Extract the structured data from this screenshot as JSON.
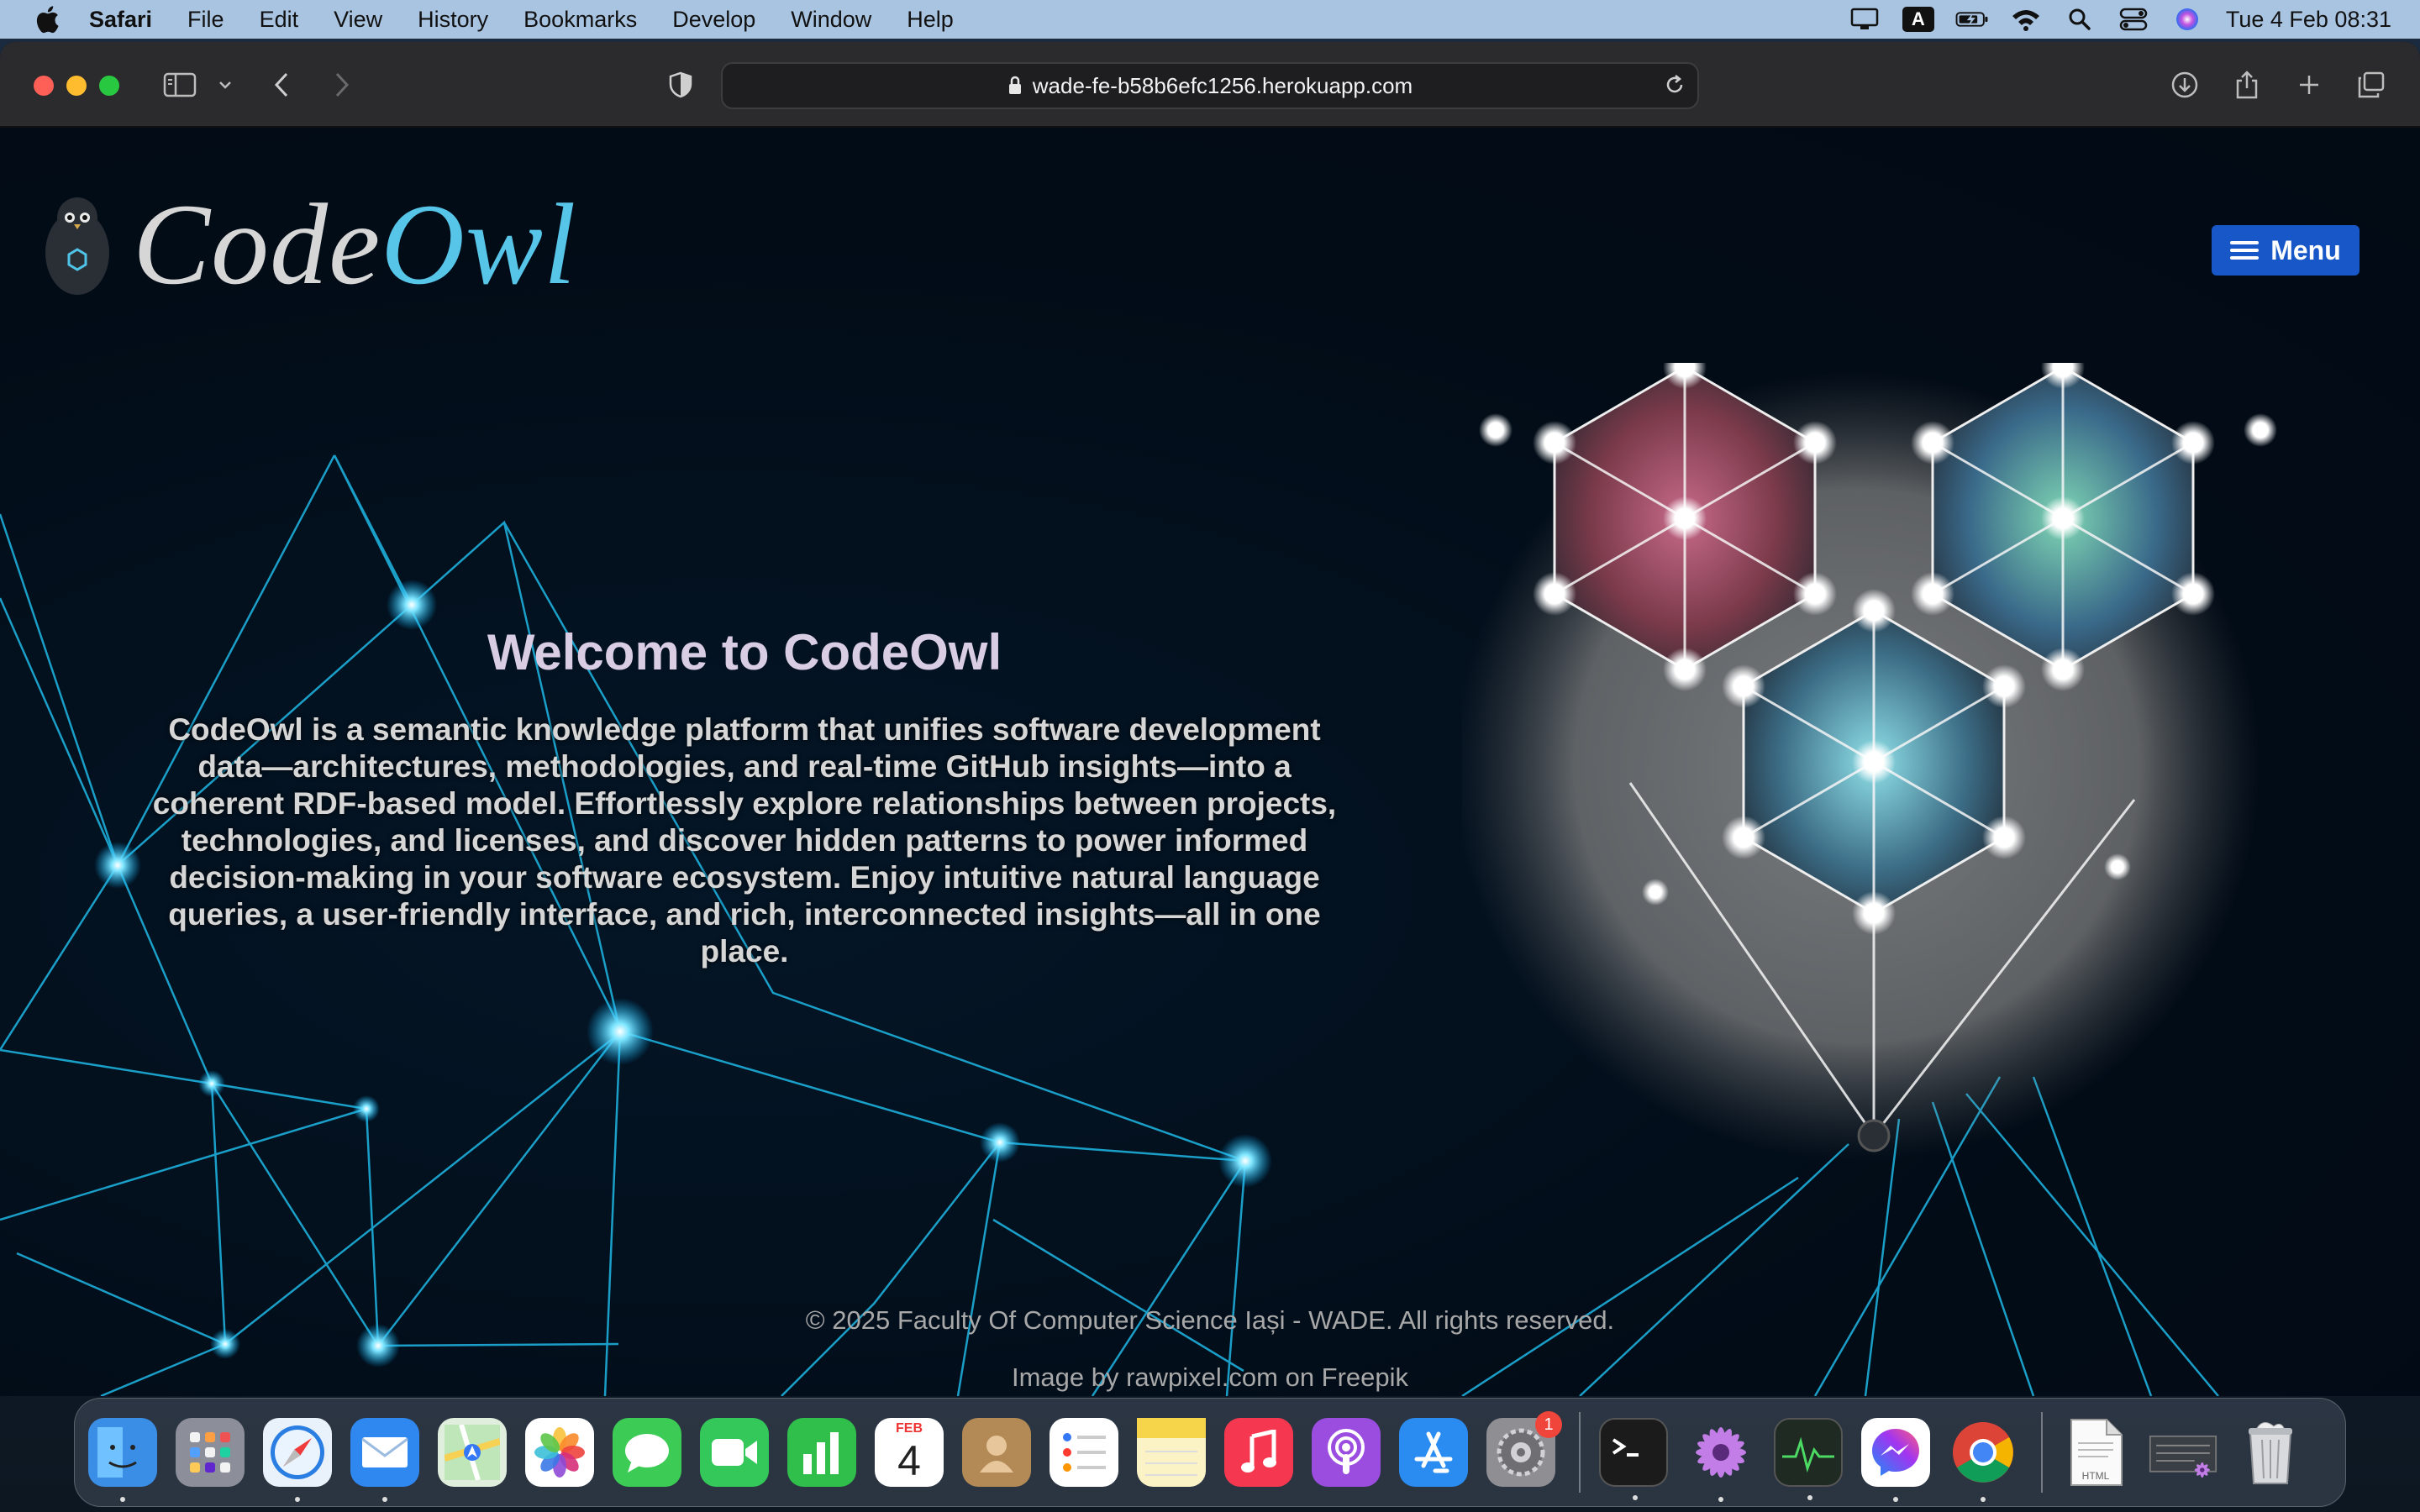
{
  "menubar": {
    "app_name": "Safari",
    "items": [
      "File",
      "Edit",
      "View",
      "History",
      "Bookmarks",
      "Develop",
      "Window",
      "Help"
    ],
    "keyboard_indicator": "A",
    "clock": "Tue 4 Feb  08:31"
  },
  "browser": {
    "url": "wade-fe-b58b6efc1256.herokuapp.com"
  },
  "site": {
    "logo_part1": "Code",
    "logo_part2": "Owl",
    "menu_label": "Menu",
    "hero_title": "Welcome to CodeOwl",
    "hero_text": "CodeOwl is a semantic knowledge platform that unifies software development data—architectures, methodologies, and real-time GitHub insights—into a coherent RDF-based model. Effortlessly explore relationships between projects, technologies, and licenses, and discover hidden patterns to power informed decision-making in your software ecosystem. Enjoy intuitive natural language queries, a user-friendly interface, and rich, interconnected insights—all in one place.",
    "copyright": "© 2025 Faculty Of Computer Science Iași - WADE. All rights reserved.",
    "image_credit": "Image by rawpixel.com on Freepik"
  },
  "dock": {
    "apps": [
      {
        "name": "Finder",
        "color": "#3a8ee6"
      },
      {
        "name": "Launchpad",
        "color": "#8c8f99"
      },
      {
        "name": "Safari",
        "color": "#2a7de1"
      },
      {
        "name": "Mail",
        "color": "#2f87f0"
      },
      {
        "name": "Maps",
        "color": "#52b86a"
      },
      {
        "name": "Photos",
        "color": "#f2f2f2"
      },
      {
        "name": "Messages",
        "color": "#3ccb55"
      },
      {
        "name": "FaceTime",
        "color": "#34c759"
      },
      {
        "name": "Numbers",
        "color": "#2fbf4a"
      },
      {
        "name": "Calendar",
        "color": "#ffffff"
      },
      {
        "name": "Contacts",
        "color": "#b38a55"
      },
      {
        "name": "Reminders",
        "color": "#ffffff"
      },
      {
        "name": "Notes",
        "color": "#f7d54a"
      },
      {
        "name": "Music",
        "color": "#f5384f"
      },
      {
        "name": "Podcasts",
        "color": "#9b4de0"
      },
      {
        "name": "App Store",
        "color": "#2a8cf0"
      },
      {
        "name": "System Settings",
        "color": "#8e8e93"
      }
    ],
    "calendar_month": "FEB",
    "calendar_day": "4",
    "settings_badge": "1",
    "apps_right": [
      {
        "name": "Terminal",
        "color": "#1b1b1b"
      },
      {
        "name": "Flower",
        "color": "#b36ad9"
      },
      {
        "name": "Activity Monitor",
        "color": "#1e2a22"
      },
      {
        "name": "Messenger",
        "color": "#7a5cf5"
      },
      {
        "name": "Chrome",
        "color": "#ffffff"
      }
    ],
    "html_doc_label": "HTML"
  }
}
